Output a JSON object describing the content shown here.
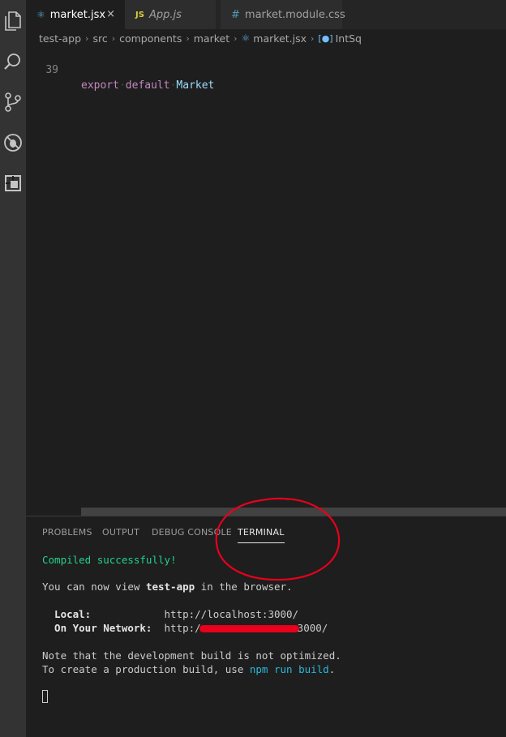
{
  "tabs": [
    {
      "label": "market.jsx",
      "icon": "react-icon",
      "active": true,
      "close": "×"
    },
    {
      "label": "App.js",
      "icon_text": "JS",
      "active": false
    },
    {
      "label": "market.module.css",
      "icon_text": "#",
      "active": false
    }
  ],
  "breadcrumb": {
    "items": [
      "test-app",
      "src",
      "components",
      "market",
      "market.jsx",
      "IntSq"
    ],
    "separator": "›"
  },
  "editor": {
    "line_number": "39",
    "keyword1": "export",
    "keyword2": "default",
    "identifier": "Market"
  },
  "panel": {
    "tabs": [
      "PROBLEMS",
      "OUTPUT",
      "DEBUG CONSOLE",
      "TERMINAL"
    ],
    "active_tab": "TERMINAL"
  },
  "terminal": {
    "compiled": "Compiled successfully!",
    "view_prefix": "You can now view ",
    "app_name": "test-app",
    "view_suffix": " in the browser.",
    "local_label": "  Local:            ",
    "local_url": "http://localhost:3000/",
    "network_label": "  On Your Network:  ",
    "network_url_prefix": "http:/",
    "network_url_suffix": "3000/",
    "note_line": "Note that the development build is not optimized.",
    "prod_prefix": "To create a production build, use ",
    "prod_cmd": "npm run build",
    "prod_suffix": "."
  },
  "colors": {
    "activity_bar": "#333333",
    "editor_bg": "#1e1e1e",
    "terminal_green": "#23d18b",
    "terminal_cyan": "#29b8db",
    "annotation_red": "#e8001c"
  }
}
